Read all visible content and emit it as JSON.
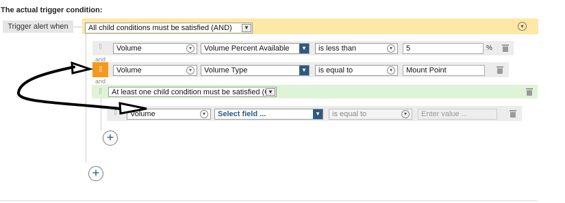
{
  "heading": "The actual trigger condition:",
  "trigger_label": "Trigger alert when",
  "root_condition": "All child conditions must be satisfied (AND)",
  "and_label": "and",
  "row1": {
    "field": "Volume",
    "property": "Volume Percent Available",
    "operator": "is less than",
    "value": "5",
    "unit": "%"
  },
  "row2": {
    "field": "Volume",
    "property": "Volume Type",
    "operator": "is equal to",
    "value": "Mount Point"
  },
  "or_group": {
    "condition": "At least one child condition must be satisfied (OR)"
  },
  "row3": {
    "field": "Volume",
    "property": "Select field ...",
    "operator": "is equal to",
    "value_placeholder": "Enter value ..."
  },
  "plus_symbol": "+",
  "colors": {
    "yellow": "#fde8a6",
    "green": "#dff3d6",
    "highlight": "#f39a1e",
    "accent": "#2d5a80"
  },
  "icons": [
    "chevron-down-icon",
    "grip-icon",
    "trash-icon",
    "add-icon",
    "arrow-annotation"
  ]
}
